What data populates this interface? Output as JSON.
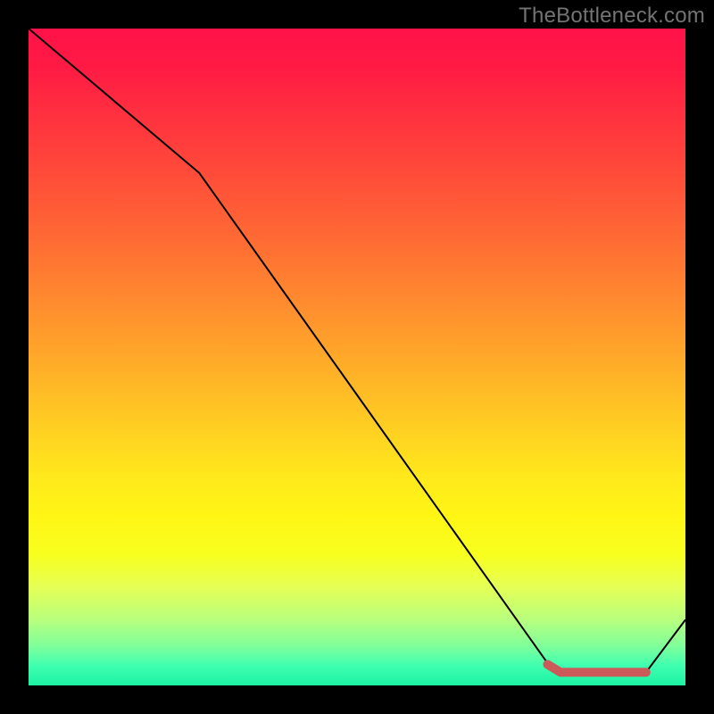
{
  "watermark": "TheBottleneck.com",
  "chart_data": {
    "type": "line",
    "title": "",
    "xlabel": "",
    "ylabel": "",
    "xlim": [
      0,
      100
    ],
    "ylim": [
      0,
      100
    ],
    "grid": false,
    "series": [
      {
        "name": "main-line",
        "color": "#000000",
        "stroke_width": 2,
        "x": [
          0,
          26,
          80,
          94,
          100
        ],
        "y": [
          100,
          78,
          2,
          2,
          10
        ]
      },
      {
        "name": "highlight-band",
        "color": "#cc5a5a",
        "stroke_width": 10,
        "x": [
          79,
          81,
          94
        ],
        "y": [
          3.2,
          2,
          2
        ]
      }
    ],
    "gradient_stops": [
      {
        "pos": 0.0,
        "color": "#ff1248"
      },
      {
        "pos": 0.46,
        "color": "#ff9a2c"
      },
      {
        "pos": 0.68,
        "color": "#ffe81c"
      },
      {
        "pos": 1.0,
        "color": "#1cf2a3"
      }
    ]
  }
}
